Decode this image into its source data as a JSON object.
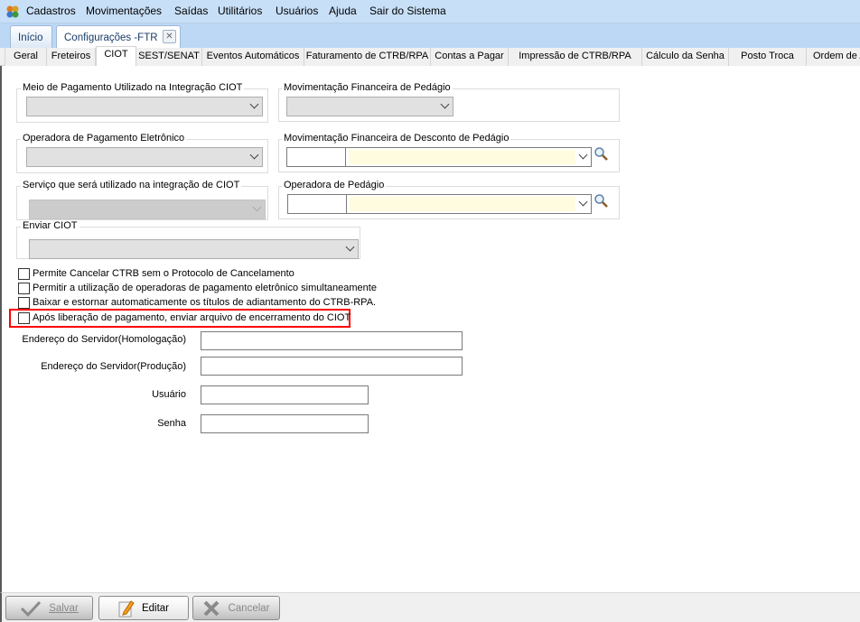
{
  "menu": [
    "Cadastros",
    "Movimentações",
    "Saídas",
    "Utilitários",
    "Usuários",
    "Ajuda",
    "Sair do Sistema"
  ],
  "doc_tabs": {
    "home": "Início",
    "active": "Configurações -FTR"
  },
  "sub_tabs": [
    "Geral",
    "Freteiros",
    "CIOT",
    "SEST/SENAT",
    "Eventos Automáticos",
    "Faturamento de CTRB/RPA",
    "Contas a Pagar",
    "Impressão de CTRB/RPA",
    "Cálculo da Senha",
    "Posto Troca",
    "Ordem de A"
  ],
  "active_sub_tab": "CIOT",
  "groups": {
    "meio_pagamento": "Meio de Pagamento Utilizado na Integração CIOT",
    "operadora_pagamento": "Operadora de Pagamento Eletrônico",
    "servico": "Serviço que será utilizado na integração de CIOT",
    "enviar_ciot": "Enviar CIOT",
    "mov_fin_pedagio": "Movimentação Financeira de Pedágio",
    "mov_fin_desconto": "Movimentação Financeira de Desconto de  Pedágio",
    "operadora_pedagio": "Operadora de Pedágio"
  },
  "checkboxes": [
    {
      "label": "Permite Cancelar CTRB sem o Protocolo de Cancelamento",
      "checked": false
    },
    {
      "label": "Permitir a utilização de operadoras de pagamento eletrônico simultaneamente",
      "checked": false
    },
    {
      "label": "Baixar e estornar automaticamente os títulos de adiantamento do CTRB-RPA.",
      "checked": false
    },
    {
      "label": "Após liberação de pagamento, enviar arquivo de encerramento do CIOT",
      "checked": false,
      "highlighted": true
    }
  ],
  "fields": {
    "homologacao": {
      "label": "Endereço do Servidor(Homologação)",
      "value": ""
    },
    "producao": {
      "label": "Endereço do Servidor(Produção)",
      "value": ""
    },
    "usuario": {
      "label": "Usuário",
      "value": ""
    },
    "senha": {
      "label": "Senha",
      "value": ""
    }
  },
  "buttons": {
    "salvar": "Salvar",
    "editar": "Editar",
    "cancelar": "Cancelar"
  },
  "colors": {
    "highlight": "#ff0000",
    "menubar": "#c7dff7",
    "combo_fill": "#fffce0"
  }
}
